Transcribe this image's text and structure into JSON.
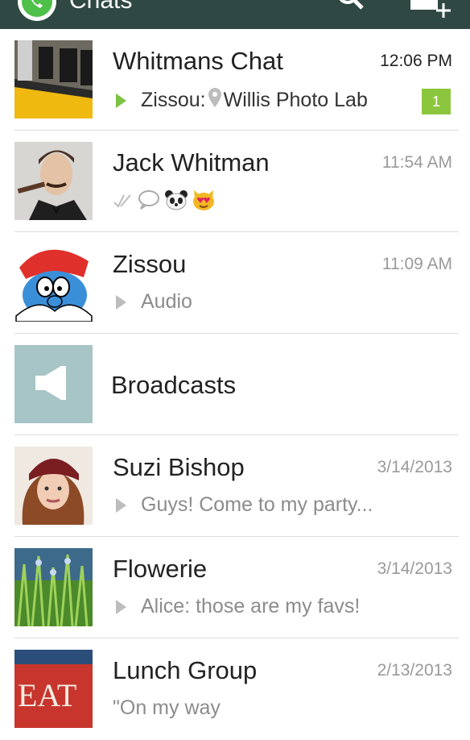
{
  "appbar": {
    "title": "Chats"
  },
  "chats": [
    {
      "name": "Whitmans Chat",
      "time": "12:06 PM",
      "sender": "Zissou:",
      "preview": "Willis Photo Lab",
      "unread": "1"
    },
    {
      "name": "Jack Whitman",
      "time": "11:54 AM",
      "preview_icons": [
        "double-check-icon",
        "speech-bubble-icon",
        "panda-emoji-icon",
        "heart-eyes-cat-emoji-icon"
      ]
    },
    {
      "name": "Zissou",
      "time": "11:09 AM",
      "preview": "Audio"
    },
    {
      "name": "Broadcasts"
    },
    {
      "name": "Suzi Bishop",
      "time": "3/14/2013",
      "preview": "Guys! Come to my party..."
    },
    {
      "name": "Flowerie",
      "time": "3/14/2013",
      "preview": "Alice: those are my favs!"
    },
    {
      "name": "Lunch Group",
      "time": "2/13/2013",
      "preview": "\"On my way"
    }
  ],
  "colors": {
    "appbar": "#2f4843",
    "accent_green": "#7cc243",
    "badge": "#8cc63e",
    "broadcast_tile": "#a7c4c6"
  }
}
